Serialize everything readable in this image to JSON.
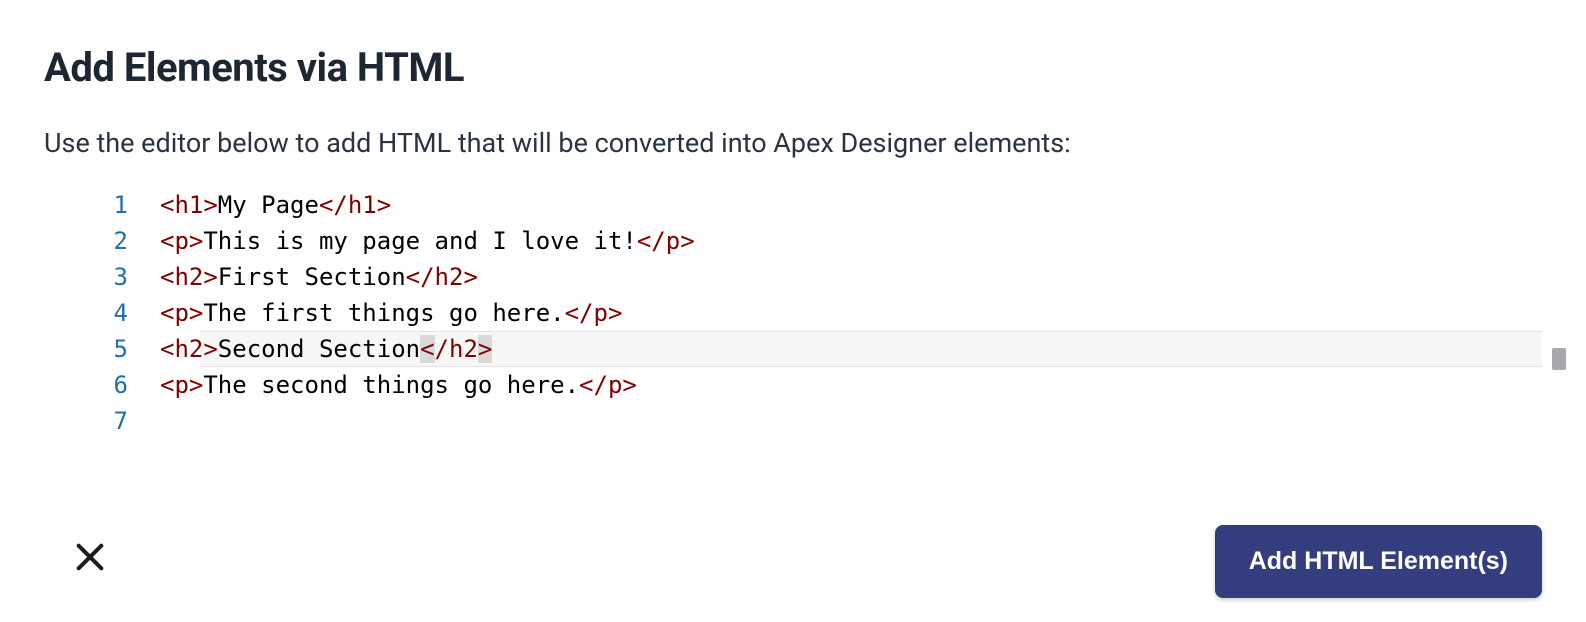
{
  "dialog": {
    "title": "Add Elements via HTML",
    "instructions": "Use the editor below to add HTML that will be converted into Apex Designer elements:"
  },
  "editor": {
    "active_line": 5,
    "lines": [
      {
        "num": "1",
        "tokens": [
          {
            "t": "tag",
            "s": "<h1>"
          },
          {
            "t": "txt",
            "s": "My Page"
          },
          {
            "t": "tag",
            "s": "</h1>"
          }
        ]
      },
      {
        "num": "2",
        "tokens": [
          {
            "t": "tag",
            "s": "<p>"
          },
          {
            "t": "txt",
            "s": "This is my page and I love it!"
          },
          {
            "t": "tag",
            "s": "</p>"
          }
        ]
      },
      {
        "num": "3",
        "tokens": [
          {
            "t": "tag",
            "s": "<h2>"
          },
          {
            "t": "txt",
            "s": "First Section"
          },
          {
            "t": "tag",
            "s": "</h2>"
          }
        ]
      },
      {
        "num": "4",
        "tokens": [
          {
            "t": "tag",
            "s": "<p>"
          },
          {
            "t": "txt",
            "s": "The first things go here."
          },
          {
            "t": "tag",
            "s": "</p>"
          }
        ]
      },
      {
        "num": "5",
        "tokens": [
          {
            "t": "tag",
            "s": "<h2>"
          },
          {
            "t": "txt",
            "s": "Second Section"
          },
          {
            "t": "tag",
            "sel": true,
            "s": "<"
          },
          {
            "t": "tag",
            "s": "/h2"
          },
          {
            "t": "tag",
            "sel": true,
            "s": ">"
          }
        ]
      },
      {
        "num": "6",
        "tokens": [
          {
            "t": "tag",
            "s": "<p>"
          },
          {
            "t": "txt",
            "s": "The second things go here."
          },
          {
            "t": "tag",
            "s": "</p>"
          }
        ]
      },
      {
        "num": "7",
        "tokens": []
      }
    ]
  },
  "footer": {
    "close_label": "Close",
    "primary_label": "Add HTML Element(s)"
  },
  "colors": {
    "accent": "#343e7e",
    "tag": "#800000",
    "line_number": "#1f6fb0"
  }
}
